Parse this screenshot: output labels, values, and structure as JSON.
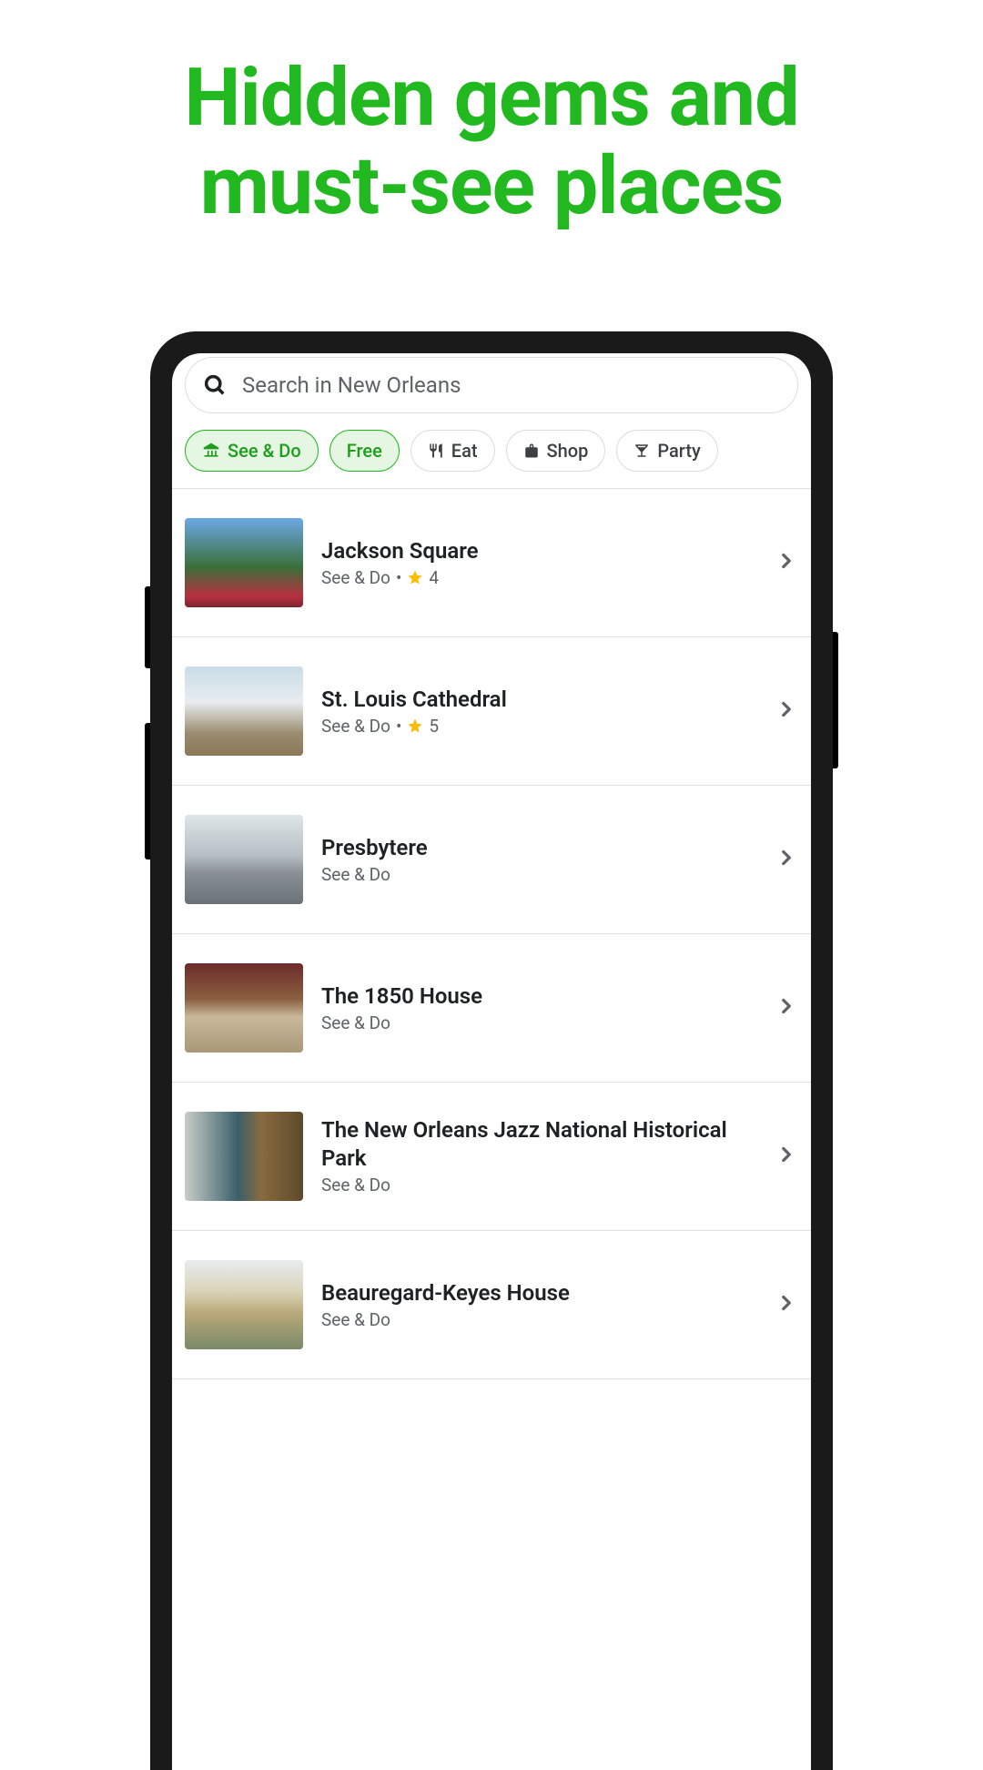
{
  "hero": {
    "line1": "Hidden gems and",
    "line2": "must-see places"
  },
  "search": {
    "placeholder": "Search in New Orleans"
  },
  "chips": [
    {
      "label": "See & Do",
      "icon": "museum-icon",
      "active": true
    },
    {
      "label": "Free",
      "icon": null,
      "active": true
    },
    {
      "label": "Eat",
      "icon": "eat-icon",
      "active": false
    },
    {
      "label": "Shop",
      "icon": "shop-icon",
      "active": false
    },
    {
      "label": "Party",
      "icon": "party-icon",
      "active": false
    }
  ],
  "items": [
    {
      "title": "Jackson Square",
      "category": "See & Do",
      "rating": 4,
      "thumbClass": "thumb-1"
    },
    {
      "title": "St. Louis Cathedral",
      "category": "See & Do",
      "rating": 5,
      "thumbClass": "thumb-2"
    },
    {
      "title": "Presbytere",
      "category": "See & Do",
      "rating": null,
      "thumbClass": "thumb-3"
    },
    {
      "title": "The 1850 House",
      "category": "See & Do",
      "rating": null,
      "thumbClass": "thumb-4"
    },
    {
      "title": "The New Orleans Jazz National Historical Park",
      "category": "See & Do",
      "rating": null,
      "thumbClass": "thumb-5"
    },
    {
      "title": "Beauregard-Keyes House",
      "category": "See & Do",
      "rating": null,
      "thumbClass": "thumb-6"
    }
  ]
}
